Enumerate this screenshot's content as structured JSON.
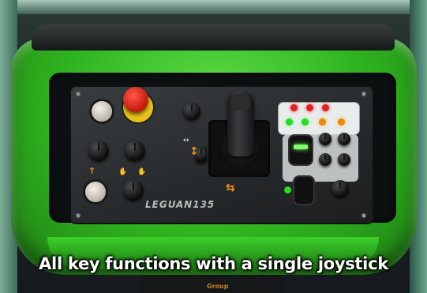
{
  "caption": "All key functions with a single joystick",
  "logo_text": "LEGUAN135",
  "console_text": "Group",
  "colors": {
    "machine_green": "#2fb21f",
    "estop_red": "#c3170d",
    "estop_yellow": "#e6c21a",
    "indicator_green": "#7dff6a",
    "arrow_orange": "#f09020"
  },
  "icons": [
    "joystick-icon",
    "emergency-stop-icon",
    "arrow-icon"
  ]
}
